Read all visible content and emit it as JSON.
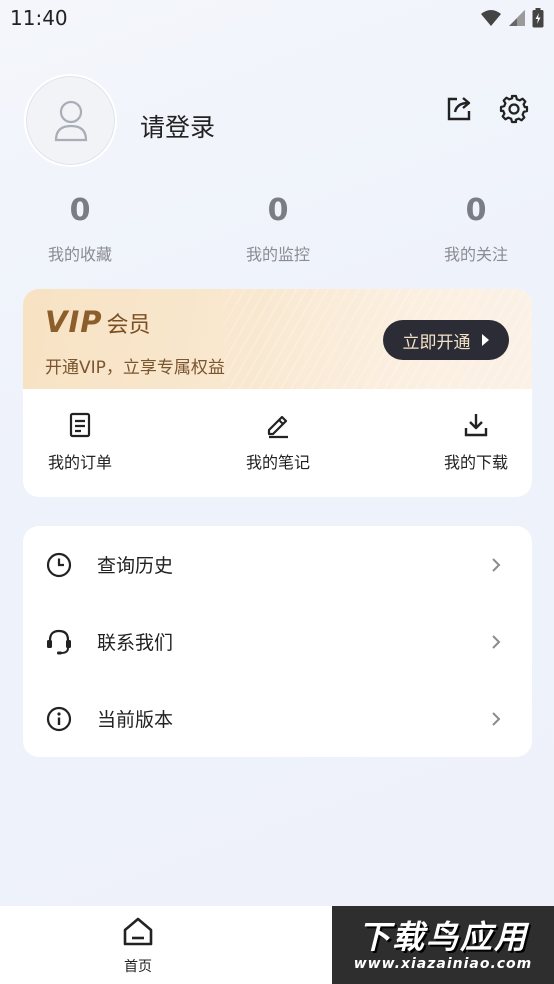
{
  "status_bar": {
    "time": "11:40"
  },
  "profile": {
    "login_text": "请登录",
    "stats": [
      {
        "value": "0",
        "label": "我的收藏"
      },
      {
        "value": "0",
        "label": "我的监控"
      },
      {
        "value": "0",
        "label": "我的关注"
      }
    ]
  },
  "icons": {
    "share": "share-icon",
    "settings": "gear-icon"
  },
  "vip": {
    "logo": "VIP",
    "title": "会员",
    "subtitle": "开通VIP，立享专属权益",
    "button": "立即开通",
    "colors": {
      "gold_text": "#8b5e2b",
      "button_bg": "#2b2c36",
      "button_text": "#f3e2c5"
    }
  },
  "quick_actions": [
    {
      "label": "我的订单",
      "icon": "document-icon"
    },
    {
      "label": "我的笔记",
      "icon": "pencil-icon"
    },
    {
      "label": "我的下载",
      "icon": "download-icon"
    }
  ],
  "menu": [
    {
      "label": "查询历史",
      "icon": "clock-icon"
    },
    {
      "label": "联系我们",
      "icon": "headset-icon"
    },
    {
      "label": "当前版本",
      "icon": "info-icon"
    }
  ],
  "bottom_nav": {
    "home_label": "首页"
  },
  "watermark": {
    "title": "下载鸟应用",
    "url": "www.xiazainiao.com"
  }
}
